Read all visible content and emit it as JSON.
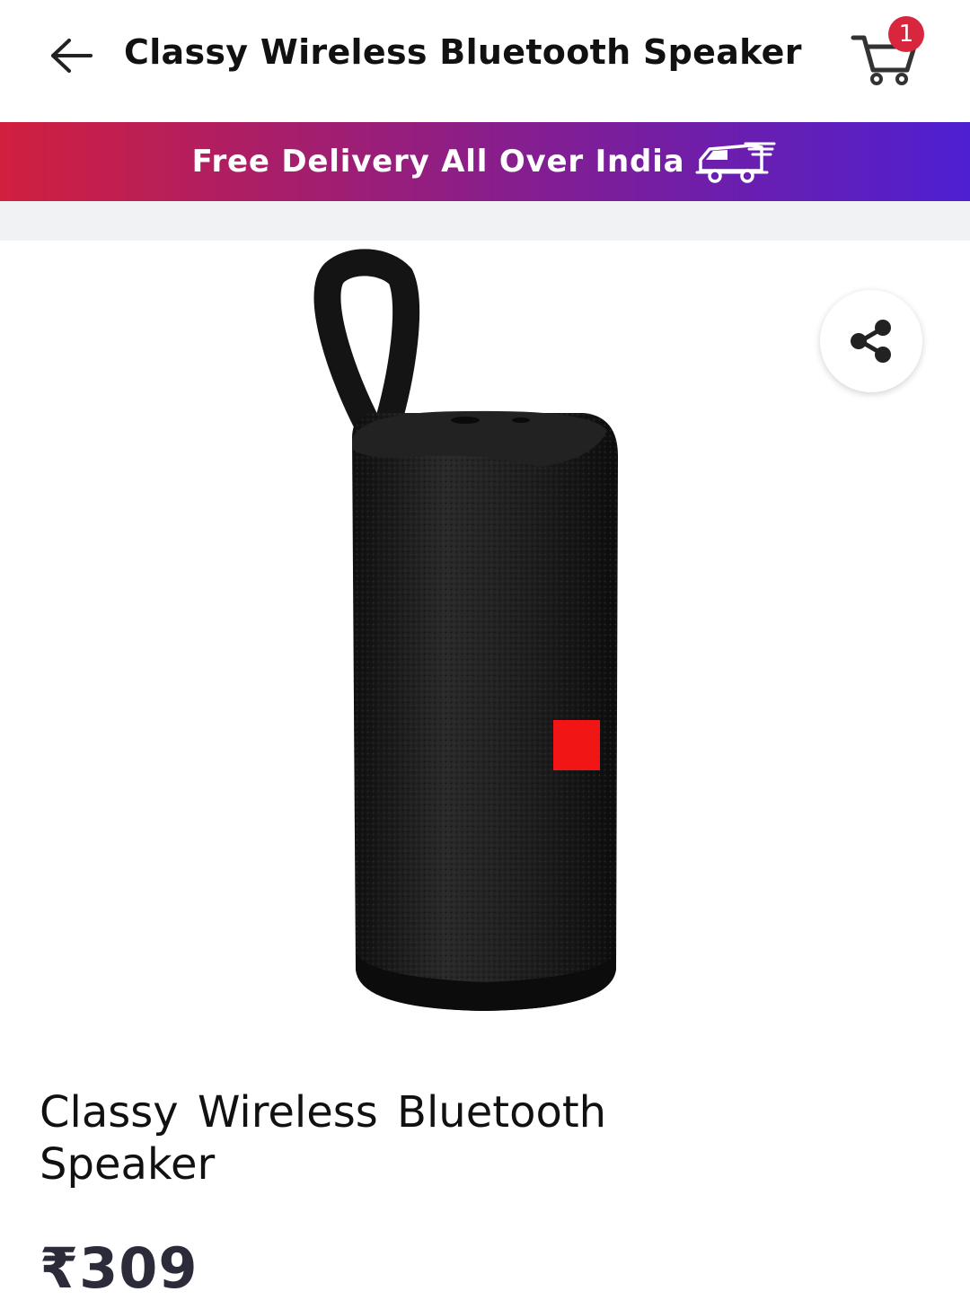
{
  "header": {
    "title": "Classy Wireless Bluetooth Speaker",
    "cart_count": "1"
  },
  "banner": {
    "text": "Free Delivery All Over India"
  },
  "product": {
    "title": "Classy Wireless Bluetooth Speaker",
    "price": "₹309"
  },
  "colors": {
    "badge": "#d7263d",
    "banner_start": "#d11f3e",
    "banner_mid": "#8a1e8a",
    "banner_end": "#4e1fd1",
    "speaker_body": "#1c1c1c",
    "speaker_accent": "#f21515"
  },
  "icons": {
    "back": "arrow-left-icon",
    "cart": "shopping-cart-icon",
    "truck": "delivery-truck-icon",
    "share": "share-icon"
  }
}
